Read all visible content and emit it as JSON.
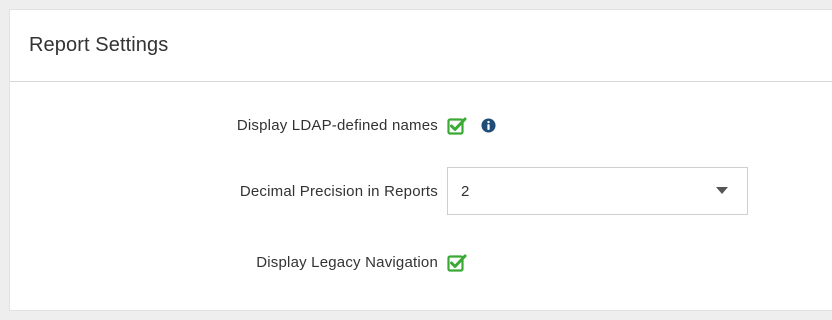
{
  "panel": {
    "title": "Report Settings"
  },
  "settings": {
    "ldap_names": {
      "label": "Display LDAP-defined names",
      "checked": true,
      "info_icon": "info-circle-icon"
    },
    "decimal_precision": {
      "label": "Decimal Precision in Reports",
      "selected_value": "2"
    },
    "legacy_navigation": {
      "label": "Display Legacy Navigation",
      "checked": true
    }
  },
  "colors": {
    "checkbox_green": "#3aa935",
    "info_blue": "#1f4d78"
  }
}
